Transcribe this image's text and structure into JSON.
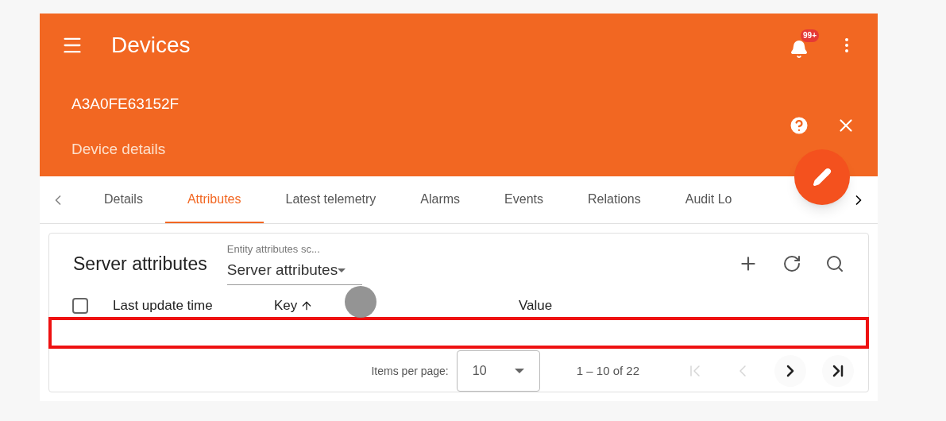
{
  "toolbar": {
    "title": "Devices",
    "notification_badge": "99+"
  },
  "device": {
    "name": "A3A0FE63152F",
    "subtitle": "Device details"
  },
  "tabs": [
    {
      "label": "Details",
      "selected": false
    },
    {
      "label": "Attributes",
      "selected": true
    },
    {
      "label": "Latest telemetry",
      "selected": false
    },
    {
      "label": "Alarms",
      "selected": false
    },
    {
      "label": "Events",
      "selected": false
    },
    {
      "label": "Relations",
      "selected": false
    },
    {
      "label": "Audit Lo",
      "selected": false
    }
  ],
  "attributes": {
    "title": "Server attributes",
    "scope_label": "Entity attributes sc...",
    "scope_value": "Server attributes",
    "table": {
      "select_all_checked": false,
      "columns": [
        {
          "label": "Last update time",
          "sorted": false
        },
        {
          "label": "Key",
          "sorted": true
        },
        {
          "label": "Value",
          "sorted": false
        }
      ]
    },
    "paginator": {
      "items_label": "Items per page:",
      "page_size": "10",
      "range": "1 – 10 of 22",
      "buttons": [
        {
          "kind": "first",
          "disabled": true
        },
        {
          "kind": "prev",
          "disabled": true
        },
        {
          "kind": "next",
          "disabled": false
        },
        {
          "kind": "last",
          "disabled": false
        }
      ]
    }
  }
}
